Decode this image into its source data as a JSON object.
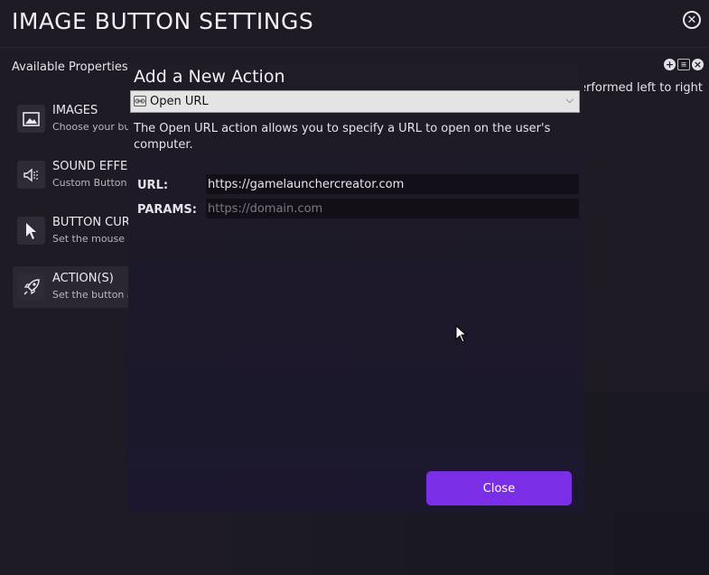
{
  "window": {
    "title": "IMAGE BUTTON SETTINGS",
    "close_icon": "close-circle-icon"
  },
  "sidebar": {
    "heading": "Available Properties",
    "items": [
      {
        "title": "IMAGES",
        "desc": "Choose your but",
        "icon": "image-icon"
      },
      {
        "title": "SOUND EFFEC",
        "desc": "Custom Button S",
        "icon": "sound-icon"
      },
      {
        "title": "BUTTON CUR",
        "desc": "Set the mouse cu",
        "icon": "cursor-icon"
      },
      {
        "title": "ACTION(S)",
        "desc": "Set the button a",
        "icon": "rocket-icon",
        "active": true
      }
    ]
  },
  "actions_panel": {
    "note": "erformed left to right"
  },
  "modal": {
    "title": "Add a New Action",
    "action_select": {
      "value": "Open URL",
      "icon": "link-icon"
    },
    "description": "The Open URL action allows you to specify a URL to open on the user's computer.",
    "url": {
      "label": "URL:",
      "value": "https://gamelaunchercreator.com"
    },
    "params": {
      "label": "PARAMS:",
      "placeholder": "https://domain.com",
      "value": ""
    },
    "close_label": "Close"
  },
  "colors": {
    "background": "#1e1b24",
    "accent": "#7a2fe6",
    "input_bg": "#121016"
  }
}
